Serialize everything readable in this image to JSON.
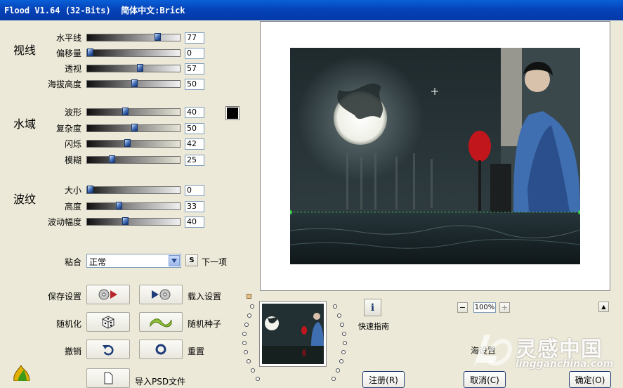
{
  "window": {
    "title": "Flood V1.64 (32-Bits)  简体中文:Brick"
  },
  "groups": [
    {
      "title": "视线",
      "sliders": [
        {
          "label": "水平线",
          "value": "77",
          "level": 0.77
        },
        {
          "label": "偏移量",
          "value": "0",
          "level": 0.0
        },
        {
          "label": "透视",
          "value": "57",
          "level": 0.57
        },
        {
          "label": "海拔高度",
          "value": "50",
          "level": 0.5
        }
      ]
    },
    {
      "title": "水域",
      "sliders": [
        {
          "label": "波形",
          "value": "40",
          "level": 0.4
        },
        {
          "label": "复杂度",
          "value": "50",
          "level": 0.5
        },
        {
          "label": "闪烁",
          "value": "42",
          "level": 0.42
        },
        {
          "label": "模糊",
          "value": "25",
          "level": 0.25
        }
      ]
    },
    {
      "title": "波纹",
      "sliders": [
        {
          "label": "大小",
          "value": "0",
          "level": 0.0
        },
        {
          "label": "高度",
          "value": "33",
          "level": 0.33
        },
        {
          "label": "波动幅度",
          "value": "40",
          "level": 0.4
        }
      ]
    }
  ],
  "blend": {
    "label": "粘合",
    "selected": "正常",
    "s_button": "S",
    "next_label": "下一项"
  },
  "actions": {
    "save_label": "保存设置",
    "load_label": "载入设置",
    "randomize_label": "随机化",
    "random_seed_label": "随机种子",
    "undo_label": "撤销",
    "reset_label": "重置",
    "import_label": "导入PSD文件"
  },
  "help": {
    "icon_text": "i",
    "label": "快速指南"
  },
  "zoom": {
    "minus": "−",
    "value": "100%",
    "plus": "+",
    "up": "▲"
  },
  "partial_text": "海设置",
  "bottom_buttons": {
    "register": "注册(R)",
    "cancel": "取消(C)",
    "ok": "确定(O)"
  },
  "watermark": {
    "brand": "灵感中国",
    "url": "lingganchina.com"
  },
  "colors": {
    "titlebar": "#0543b8",
    "water_color_swatch": "#000000",
    "accent": "#1f3b73"
  }
}
